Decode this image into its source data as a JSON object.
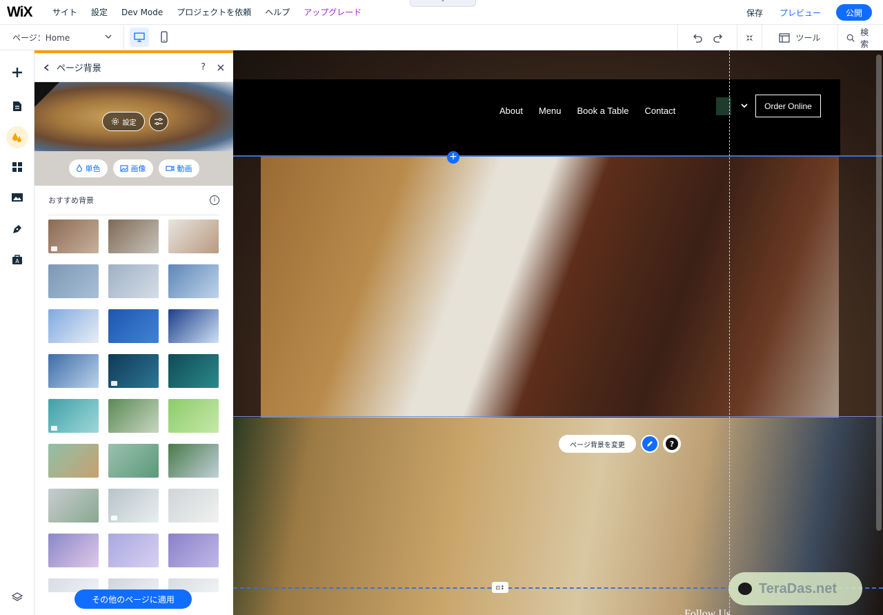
{
  "topbar": {
    "logo": "WiX",
    "menu": [
      "サイト",
      "設定",
      "Dev Mode",
      "プロジェクトを依頼",
      "ヘルプ",
      "アップグレード"
    ],
    "collapse": "⌃",
    "save": "保存",
    "preview": "プレビュー",
    "publish": "公開"
  },
  "secondbar": {
    "page_selector": "ページ：Home",
    "tools": "ツール",
    "search": "検索"
  },
  "panel": {
    "title": "ページ背景",
    "help": "?",
    "settings_label": "設定",
    "type_buttons": [
      "単色",
      "画像",
      "動画"
    ],
    "section_title": "おすすめ背景",
    "apply_button": "その他のページに適用",
    "thumbnails": [
      {
        "colors": [
          "#8a6a55",
          "#c7b09a"
        ],
        "video": true
      },
      {
        "colors": [
          "#7e6a55",
          "#c7c2ba"
        ],
        "video": false
      },
      {
        "colors": [
          "#e8e4df",
          "#b89a80"
        ],
        "video": false
      },
      {
        "colors": [
          "#7d98b4",
          "#a8c0d6"
        ],
        "video": false
      },
      {
        "colors": [
          "#9fb0c4",
          "#d4dde6"
        ],
        "video": false
      },
      {
        "colors": [
          "#5d86b8",
          "#c0d4ea"
        ],
        "video": false
      },
      {
        "colors": [
          "#7fa9e0",
          "#e8eef6"
        ],
        "video": false
      },
      {
        "colors": [
          "#1f55b0",
          "#3f84d6"
        ],
        "video": false
      },
      {
        "colors": [
          "#1c3f8a",
          "#cfe0f5"
        ],
        "video": false
      },
      {
        "colors": [
          "#3d6ca8",
          "#bcd3ea"
        ],
        "video": false
      },
      {
        "colors": [
          "#0f3a55",
          "#2d7696"
        ],
        "video": true
      },
      {
        "colors": [
          "#0f4a55",
          "#2a8a8a"
        ],
        "video": false
      },
      {
        "colors": [
          "#3fa0a8",
          "#9fd8d8"
        ],
        "video": true
      },
      {
        "colors": [
          "#5a8a55",
          "#c8d6c0"
        ],
        "video": false
      },
      {
        "colors": [
          "#8ccc6a",
          "#c6e8a8"
        ],
        "video": false
      },
      {
        "colors": [
          "#8fc0a8",
          "#c8a070"
        ],
        "video": false
      },
      {
        "colors": [
          "#9cc0ad",
          "#5a9a7a"
        ],
        "video": false
      },
      {
        "colors": [
          "#4a7a4a",
          "#c0d0d8"
        ],
        "video": false
      },
      {
        "colors": [
          "#c8ccd0",
          "#8aa890"
        ],
        "video": false
      },
      {
        "colors": [
          "#b8c4c8",
          "#e8eef0"
        ],
        "video": true
      },
      {
        "colors": [
          "#d0d4d8",
          "#f0f2f0"
        ],
        "video": false
      },
      {
        "colors": [
          "#8a88c8",
          "#e0c8e8"
        ],
        "video": false
      },
      {
        "colors": [
          "#a8a8e0",
          "#d8d0f0"
        ],
        "video": false
      },
      {
        "colors": [
          "#8a80c8",
          "#c0b8e8"
        ],
        "video": false
      },
      {
        "colors": [
          "#d8dde4",
          "#eef0f4"
        ],
        "video": false
      },
      {
        "colors": [
          "#d0d4dc",
          "#eceef2"
        ],
        "video": false
      },
      {
        "colors": [
          "#d8dce0",
          "#f0f2f4"
        ],
        "video": false
      }
    ]
  },
  "canvas": {
    "nav": [
      "About",
      "Menu",
      "Book a Table",
      "Contact"
    ],
    "order_online": "Order Online",
    "change_background": "ページ背景を変更",
    "help": "?",
    "follow": "Follow Us",
    "chat_watermark": "TeraDas.net",
    "anchor_label": "⊡↕"
  }
}
